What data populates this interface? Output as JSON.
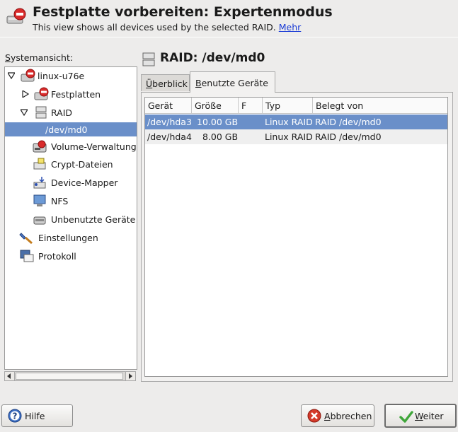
{
  "header": {
    "title": "Festplatte vorbereiten: Expertenmodus",
    "subtitle": "This view shows all devices used by the selected RAID.",
    "link": "Mehr"
  },
  "sidebar": {
    "label_mnemonic": "S",
    "label_rest": "ystemansicht:",
    "items": [
      {
        "label": "linux-u76e",
        "icon": "computer-disk-icon"
      },
      {
        "label": "Festplatten",
        "icon": "hard-disk-icon"
      },
      {
        "label": "RAID",
        "icon": "raid-icon"
      },
      {
        "label": "/dev/md0",
        "icon": ""
      },
      {
        "label": "Volume-Verwaltung",
        "icon": "volume-icon"
      },
      {
        "label": "Crypt-Dateien",
        "icon": "crypt-icon"
      },
      {
        "label": "Device-Mapper",
        "icon": "device-mapper-icon"
      },
      {
        "label": "NFS",
        "icon": "nfs-icon"
      },
      {
        "label": "Unbenutzte Geräte",
        "icon": "unused-devices-icon"
      },
      {
        "label": "Einstellungen",
        "icon": "settings-icon"
      },
      {
        "label": "Protokoll",
        "icon": "log-icon"
      }
    ]
  },
  "main": {
    "title": "RAID: /dev/md0",
    "tabs": [
      {
        "mnemonic": "Ü",
        "rest": "berblick"
      },
      {
        "mnemonic": "B",
        "rest": "enutzte Geräte"
      }
    ],
    "table": {
      "columns": [
        "Gerät",
        "Größe",
        "F",
        "Typ",
        "Belegt von"
      ],
      "rows": [
        [
          "/dev/hda3",
          "10.00 GB",
          "",
          "Linux RAID",
          "RAID /dev/md0"
        ],
        [
          "/dev/hda4",
          "8.00 GB",
          "",
          "Linux RAID",
          "RAID /dev/md0"
        ]
      ]
    }
  },
  "buttons": {
    "help": {
      "mnemonic": "",
      "rest": "Hilfe"
    },
    "cancel": {
      "mnemonic": "A",
      "rest": "bbrechen"
    },
    "next": {
      "mnemonic": "W",
      "rest": "eiter"
    }
  },
  "colors": {
    "selection": "#6a8fc9",
    "background": "#edeceb",
    "link": "#1a3bd6"
  }
}
